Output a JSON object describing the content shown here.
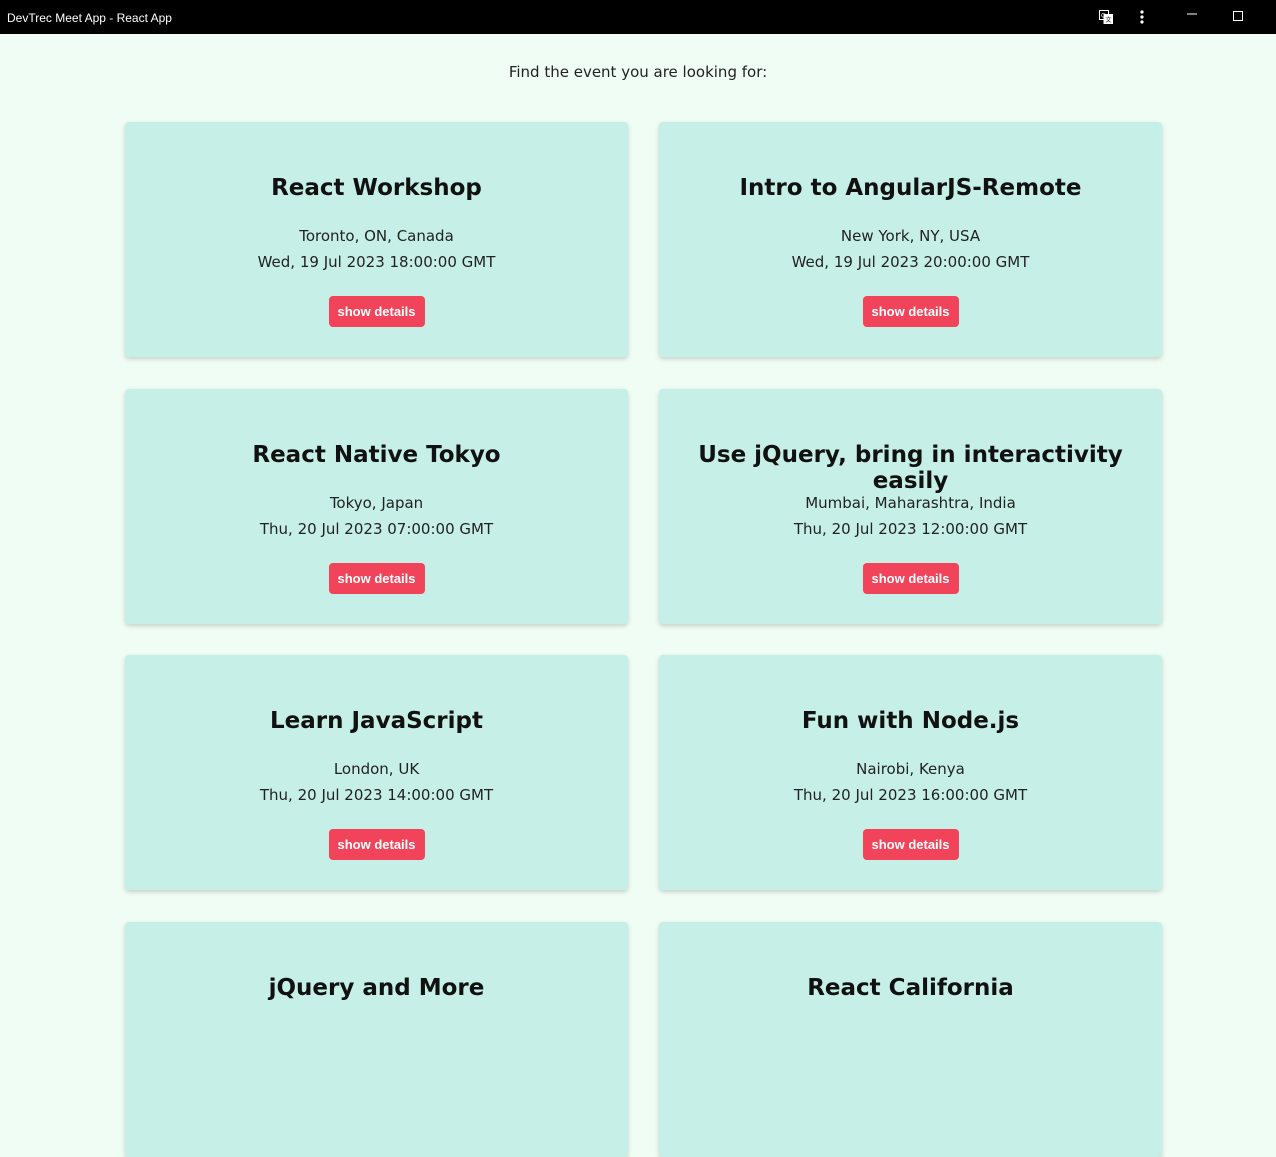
{
  "window": {
    "title": "DevTrec Meet App - React App",
    "icons": [
      "translate-icon",
      "more-vertical-icon",
      "minimize-icon",
      "maximize-icon"
    ]
  },
  "header": {
    "prompt": "Find the event you are looking for:"
  },
  "colors": {
    "page_background": "#effdf4",
    "card_background": "#c6f0e7",
    "button_background": "#f1435a",
    "button_text": "#ffffff"
  },
  "events": [
    {
      "name": "React Workshop",
      "location": "Toronto, ON, Canada",
      "time": "Wed, 19 Jul 2023 18:00:00 GMT",
      "button_label": "show details"
    },
    {
      "name": "Intro to AngularJS-Remote",
      "location": "New York, NY, USA",
      "time": "Wed, 19 Jul 2023 20:00:00 GMT",
      "button_label": "show details"
    },
    {
      "name": "React Native Tokyo",
      "location": "Tokyo, Japan",
      "time": "Thu, 20 Jul 2023 07:00:00 GMT",
      "button_label": "show details"
    },
    {
      "name": "Use jQuery, bring in interactivity easily",
      "location": "Mumbai, Maharashtra, India",
      "time": "Thu, 20 Jul 2023 12:00:00 GMT",
      "button_label": "show details"
    },
    {
      "name": "Learn JavaScript",
      "location": "London, UK",
      "time": "Thu, 20 Jul 2023 14:00:00 GMT",
      "button_label": "show details"
    },
    {
      "name": "Fun with Node.js",
      "location": "Nairobi, Kenya",
      "time": "Thu, 20 Jul 2023 16:00:00 GMT",
      "button_label": "show details"
    },
    {
      "name": "jQuery and More",
      "location": "",
      "time": "",
      "button_label": ""
    },
    {
      "name": "React California",
      "location": "",
      "time": "",
      "button_label": ""
    }
  ]
}
